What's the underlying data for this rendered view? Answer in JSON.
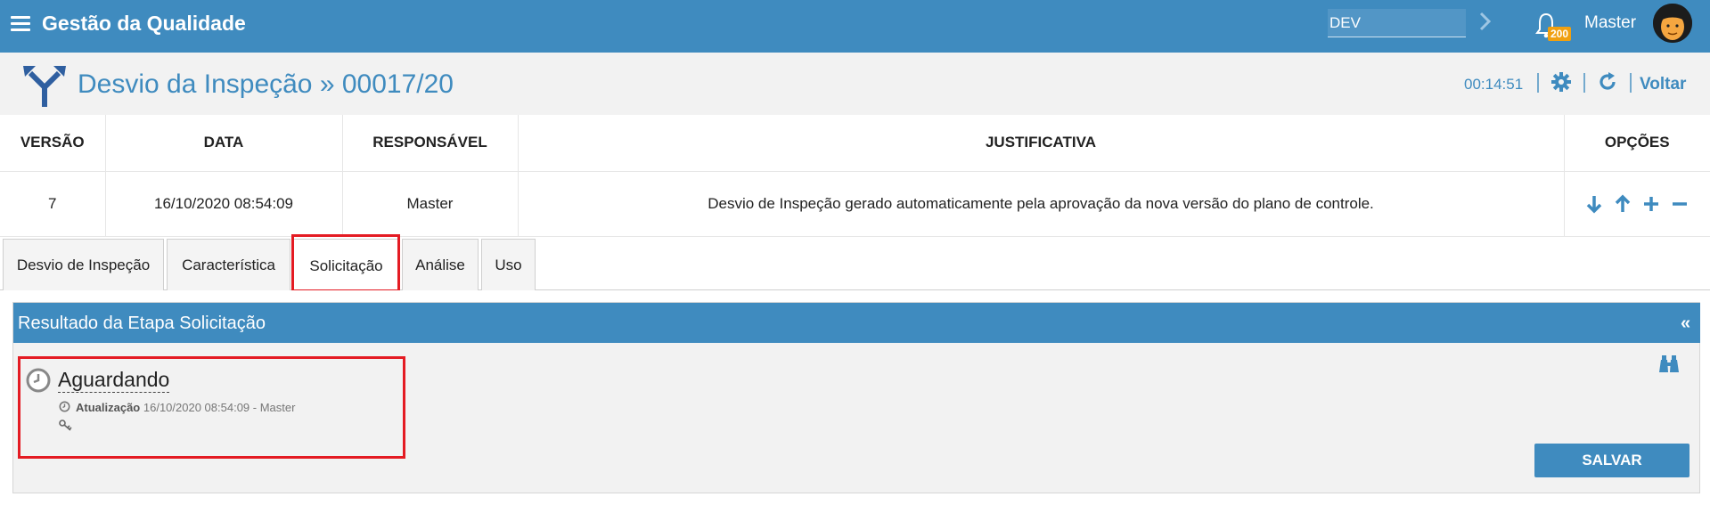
{
  "app": {
    "title": "Gestão da Qualidade",
    "environment": "DEV",
    "notifications": "200",
    "user": "Master"
  },
  "page": {
    "title": "Desvio da Inspeção » 00017/20",
    "timer": "00:14:51",
    "back": "Voltar"
  },
  "table": {
    "headers": [
      "VERSÃO",
      "DATA",
      "RESPONSÁVEL",
      "JUSTIFICATIVA",
      "OPÇÕES"
    ],
    "rows": [
      [
        "7",
        "16/10/2020 08:54:09",
        "Master",
        "Desvio de Inspeção gerado automaticamente pela aprovação da nova versão do plano de controle."
      ]
    ]
  },
  "tabs": [
    {
      "label": "Desvio de Inspeção"
    },
    {
      "label": "Característica"
    },
    {
      "label": "Solicitação"
    },
    {
      "label": "Análise"
    },
    {
      "label": "Uso"
    }
  ],
  "panel": {
    "title": "Resultado da Etapa Solicitação",
    "collapse": "«",
    "status": "Aguardando",
    "update_label": "Atualização",
    "update_value": "16/10/2020 08:54:09 - Master",
    "save": "SALVAR"
  },
  "colors": {
    "primary": "#3f8bbf",
    "highlight": "#e41b23",
    "badge": "#f0a010"
  }
}
